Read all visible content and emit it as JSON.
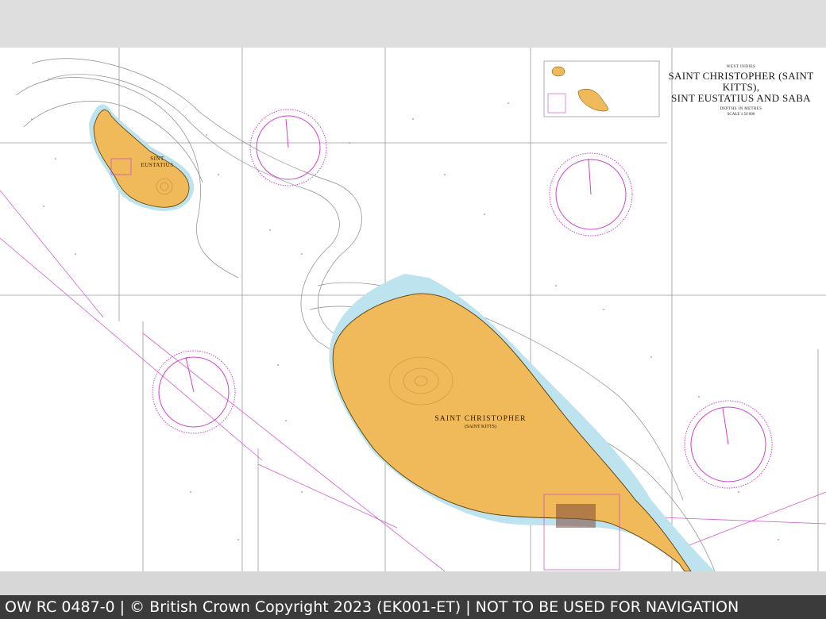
{
  "chart": {
    "region": "WEST INDIES",
    "title_line1": "SAINT CHRISTOPHER (SAINT KITTS),",
    "title_line2": "SINT EUSTATIUS AND SABA",
    "depth_units": "DEPTHS IN METRES",
    "scale": "SCALE 1:50 000",
    "islands": [
      {
        "name": "SINT",
        "name2": "EUSTATIUS"
      },
      {
        "name": "SAINT CHRISTOPHER",
        "subname": "(SAINT KITTS)"
      }
    ]
  },
  "footer": {
    "text": "OW RC 0487-0 | © British Crown Copyright 2023 (EK001-ET) | NOT TO BE USED FOR NAVIGATION"
  },
  "colors": {
    "land": "#f0b95a",
    "shallow": "#bde3ee",
    "compass": "#cc44cc",
    "grid": "#9a9a9a",
    "depth_contour": "#8a8a8a",
    "route": "#d35cd3"
  }
}
